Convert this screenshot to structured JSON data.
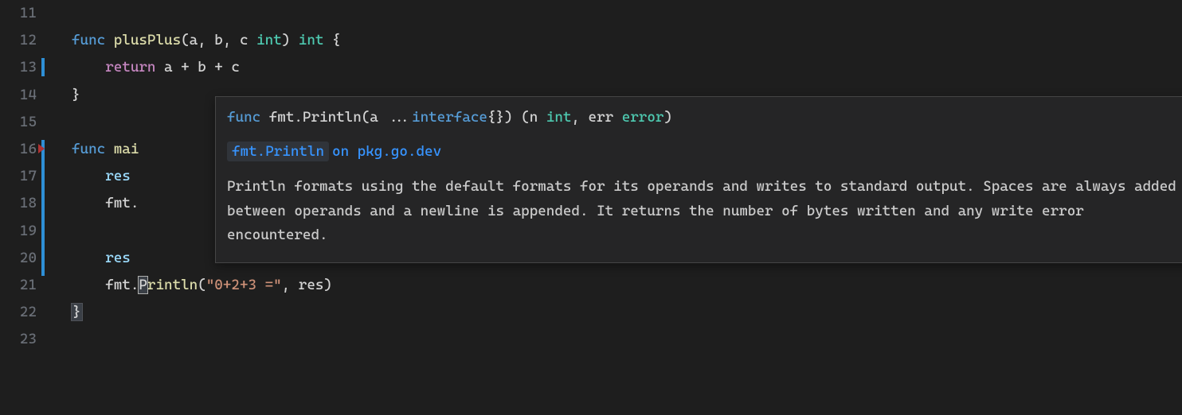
{
  "gutter": {
    "start": 11,
    "end": 23,
    "modified": [
      13,
      16,
      17,
      18,
      19,
      20
    ]
  },
  "code": {
    "l11": "",
    "l12": {
      "func": "func",
      "name": "plusPlus",
      "params": "(a, b, c ",
      "ptype": "int",
      "paren2": ") ",
      "rtype": "int",
      "brace": " {"
    },
    "l13": {
      "indent": "    ",
      "ret": "return",
      "expr": " a + b + c"
    },
    "l14": "}",
    "l15": "",
    "l16": {
      "func": "func",
      "name_partial": " mai"
    },
    "l17": {
      "indent": "    ",
      "obscured": "res "
    },
    "l18": {
      "indent": "    ",
      "obscured": "fmt."
    },
    "l19": "",
    "l20": {
      "indent": "    ",
      "obscured": "res "
    },
    "l21": {
      "indent": "    ",
      "obj": "fmt.",
      "cursor_char": "P",
      "rest": "rintln",
      "open": "(",
      "str": "\"0+2+3 =\"",
      "args": ", res)"
    },
    "l22": "}",
    "l23": ""
  },
  "hover": {
    "signature": {
      "func": "func",
      "pkg_call": " fmt.Println(a ...",
      "iface": "interface",
      "iface_tail": "{}) (n ",
      "int_t": "int",
      "mid": ", err ",
      "err_t": "error",
      "end": ")"
    },
    "link_name": "fmt.Println",
    "link_suffix": "on pkg.go.dev",
    "description": "Println formats using the default formats for its operands and writes to standard output. Spaces are always added between operands and a newline is appended. It returns the number of bytes written and any write error encountered."
  }
}
